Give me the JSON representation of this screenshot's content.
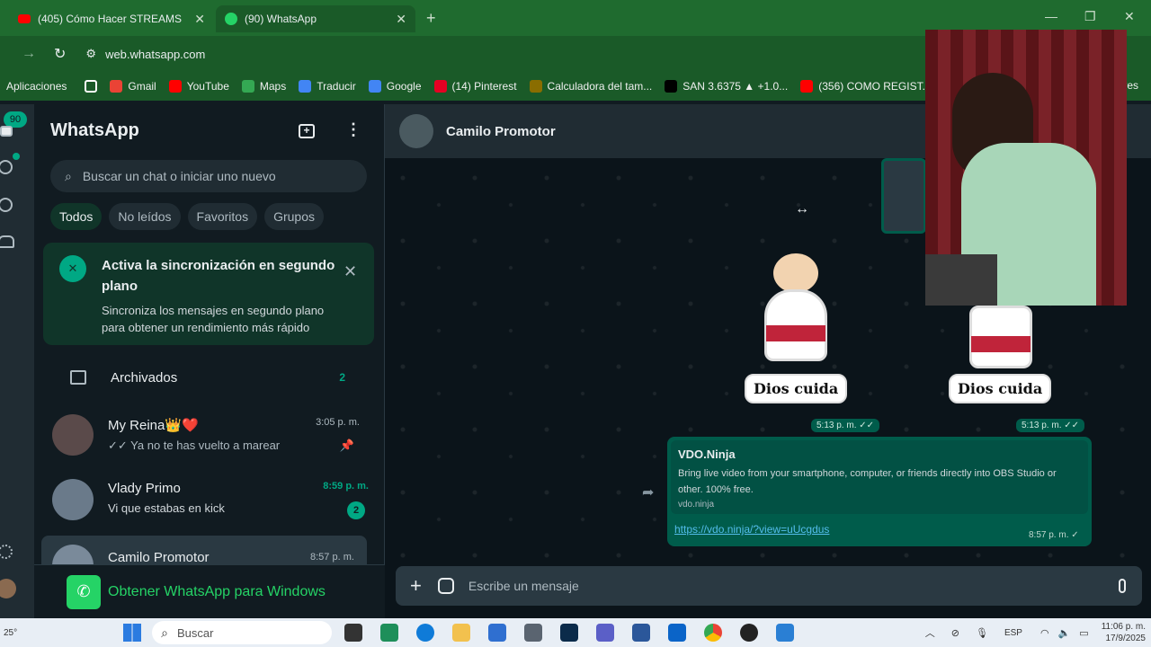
{
  "browser": {
    "tabs": [
      {
        "label": "(405) Cómo Hacer STREAMS en",
        "icon": "youtube-icon",
        "active": false
      },
      {
        "label": "(90) WhatsApp",
        "icon": "whatsapp-icon",
        "active": true
      }
    ],
    "url": "web.whatsapp.com",
    "bookmarks": [
      {
        "label": "Aplicaciones",
        "icon": "apps-grid-icon",
        "color": "#ffffff"
      },
      {
        "label": "Gmail",
        "icon": "gmail-icon",
        "color": "#ea4335"
      },
      {
        "label": "YouTube",
        "icon": "youtube-icon",
        "color": "#ff0000"
      },
      {
        "label": "Maps",
        "icon": "maps-icon",
        "color": "#34a853"
      },
      {
        "label": "Traducir",
        "icon": "translate-icon",
        "color": "#4285f4"
      },
      {
        "label": "Google",
        "icon": "google-icon",
        "color": "#4285f4"
      },
      {
        "label": "(14) Pinterest",
        "icon": "pinterest-icon",
        "color": "#e60023"
      },
      {
        "label": "Calculadora del tam...",
        "icon": "calculator-icon",
        "color": "#8a6d00"
      },
      {
        "label": "SAN 3.6375 ▲ +1.0...",
        "icon": "tradingview-icon",
        "color": "#000000"
      },
      {
        "label": "(356) COMO REGIST...",
        "icon": "youtube-icon",
        "color": "#ff0000"
      }
    ],
    "bookmarks_more": "res"
  },
  "rail": {
    "unread_badge": "90"
  },
  "sidebar": {
    "title": "WhatsApp",
    "search_placeholder": "Buscar un chat o iniciar uno nuevo",
    "filters": [
      "Todos",
      "No leídos",
      "Favoritos",
      "Grupos"
    ],
    "banner": {
      "title": "Activa la sincronización en segundo plano",
      "body": "Sincroniza los mensajes en segundo plano para obtener un rendimiento más rápido"
    },
    "archived": {
      "label": "Archivados",
      "count": "2"
    },
    "chats": [
      {
        "name": "My Reina👑❤️",
        "time": "3:05 p. m.",
        "preview": "✓✓ Ya no te has vuelto a marear",
        "pinned": true,
        "unread": "",
        "avatar_color": "#5a4a4a"
      },
      {
        "name": "Vlady Primo",
        "time": "8:59 p. m.",
        "preview": "Vi que estabas en kick",
        "pinned": false,
        "unread": "2",
        "avatar_color": "#6a7a8a"
      },
      {
        "name": "Camilo Promotor",
        "time": "8:57 p. m.",
        "preview": "",
        "pinned": false,
        "unread": "",
        "avatar_color": "#7a8a9a"
      }
    ],
    "get_app": "Obtener WhatsApp para Windows"
  },
  "chat": {
    "contact_name": "Camilo Promotor",
    "stickers": [
      {
        "label": "Dios cuida",
        "time": "5:13 p. m. ✓✓"
      },
      {
        "label": "Dios cuida",
        "time": "5:13 p. m. ✓✓"
      }
    ],
    "link_message": {
      "title": "VDO.Ninja",
      "description": "Bring live video from your smartphone, computer, or friends directly into OBS Studio or other. 100% free.",
      "domain": "vdo.ninja",
      "url": "https://vdo.ninja/?view=uUcgdus",
      "time": "8:57 p. m. ✓"
    },
    "composer_placeholder": "Escribe un mensaje"
  },
  "taskbar": {
    "weather": "25°",
    "search_label": "Buscar",
    "lang": "ESP",
    "time": "11:06 p. m.",
    "date": "17/9/2025"
  },
  "colors": {
    "accent": "#00a884",
    "banner_bg": "#103529",
    "outgoing_bubble": "#005c4b",
    "browser_green": "#1a5a28"
  }
}
